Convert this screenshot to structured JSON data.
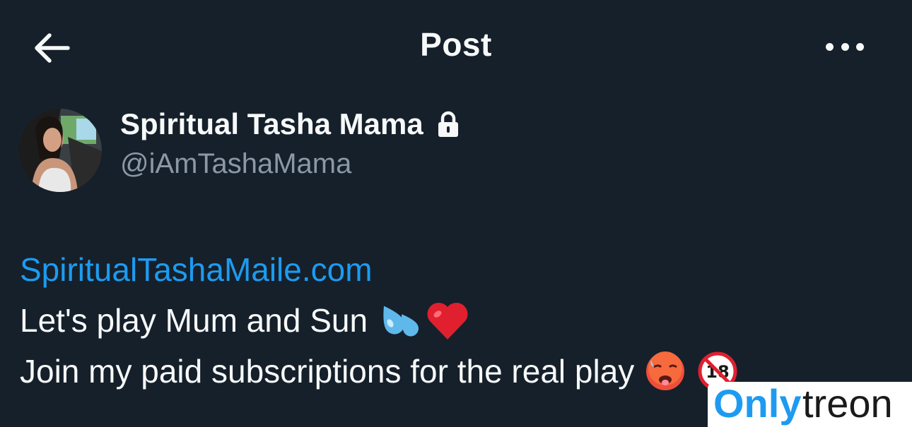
{
  "header": {
    "title": "Post",
    "back_icon": "arrow-left-icon",
    "more_icon": "more-horizontal-icon"
  },
  "author": {
    "display_name": "Spiritual Tasha Mama",
    "handle": "@iAmTashaMama",
    "protected_icon": "lock-icon",
    "avatar_icon": "profile-avatar"
  },
  "post": {
    "link": "SpiritualTashaMaile.com",
    "line1": "Let's play Mum and Sun",
    "line1_emojis": [
      "sweat-droplets-emoji",
      "red-heart-emoji"
    ],
    "line2": "Join my paid subscriptions for the real play",
    "line2_emojis": [
      "hot-face-emoji",
      "no-one-under-eighteen-emoji"
    ]
  },
  "watermark": {
    "text_part1": "Only",
    "text_part2": "treon"
  },
  "colors": {
    "background": "#15202b",
    "text": "#f7f9f9",
    "secondary_text": "#8b98a5",
    "link": "#1d9bf0",
    "watermark_blue": "#1e9bf0",
    "watermark_dark": "#1a1a1a"
  }
}
